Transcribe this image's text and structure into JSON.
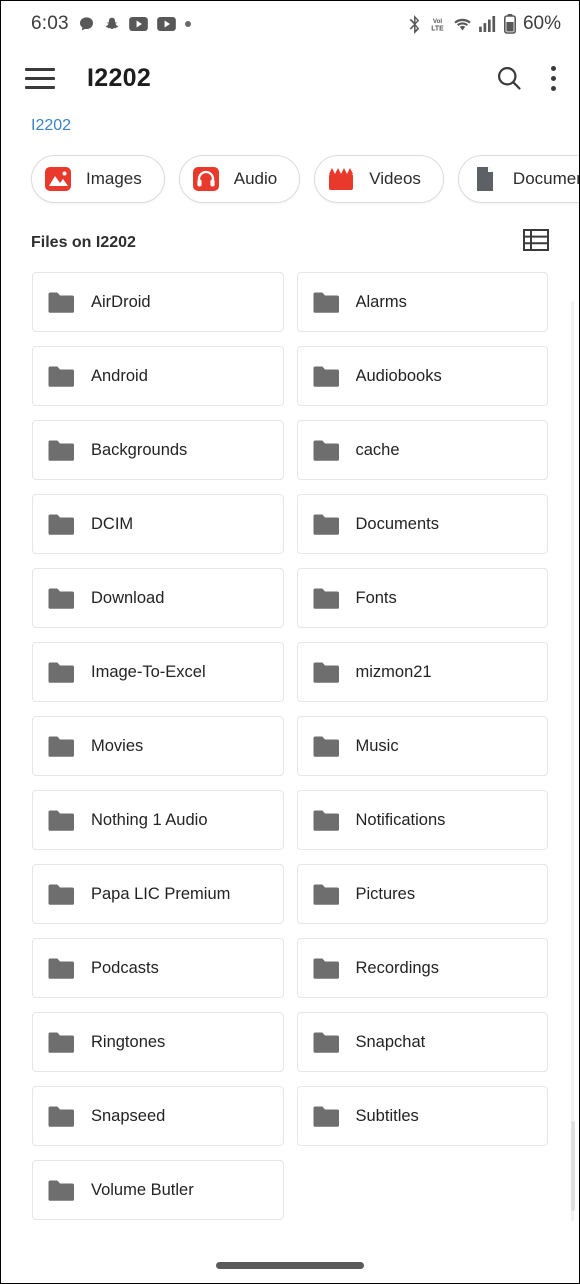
{
  "status_bar": {
    "time": "6:03",
    "battery_percent": "60%",
    "left_icons": [
      "chat-bubble-icon",
      "snapchat-icon",
      "youtube-icon",
      "youtube-icon",
      "notification-dot-icon"
    ],
    "right_icons": [
      "bluetooth-icon",
      "volte-icon",
      "wifi-icon",
      "signal-bars-icon",
      "battery-icon"
    ],
    "volte_label": "VoLTE"
  },
  "app_bar": {
    "title": "I2202",
    "menu_icon": "hamburger-menu-icon",
    "search_icon": "search-icon",
    "overflow_icon": "more-vertical-icon"
  },
  "breadcrumb": {
    "path": "I2202"
  },
  "filters": {
    "chips": [
      {
        "label": "Images",
        "icon": "image-icon",
        "color": "#e8392c"
      },
      {
        "label": "Audio",
        "icon": "headphones-icon",
        "color": "#e8392c"
      },
      {
        "label": "Videos",
        "icon": "clapperboard-icon",
        "color": "#e8392c"
      },
      {
        "label": "Documents",
        "icon": "document-icon",
        "color": "#5d6165"
      },
      {
        "label": "",
        "icon": "more-chip-icon",
        "color": "#5d6165"
      }
    ]
  },
  "section": {
    "title": "Files on I2202",
    "view_toggle_icon": "list-view-icon"
  },
  "folders": [
    "AirDroid",
    "Alarms",
    "Android",
    "Audiobooks",
    "Backgrounds",
    "cache",
    "DCIM",
    "Documents",
    "Download",
    "Fonts",
    "Image-To-Excel",
    "mizmon21",
    "Movies",
    "Music",
    "Nothing 1 Audio",
    "Notifications",
    "Papa LIC Premium",
    "Pictures",
    "Podcasts",
    "Recordings",
    "Ringtones",
    "Snapchat",
    "Snapseed",
    "Subtitles",
    "Volume Butler"
  ],
  "colors": {
    "accent_red": "#e8392c",
    "breadcrumb_blue": "#3b83c4",
    "folder_gray": "#6e6e6e",
    "card_border": "#e6e6e6",
    "text_primary": "#232323"
  }
}
